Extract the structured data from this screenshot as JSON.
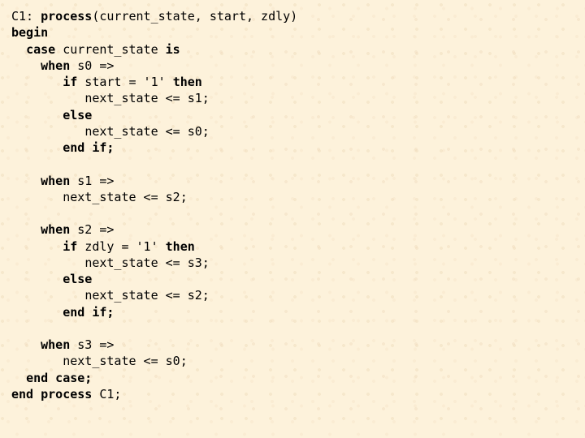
{
  "code": {
    "l01a": "C1: ",
    "l01b": "process",
    "l01c": "(current_state, start, zdly)",
    "l02": "begin",
    "l03a": "case",
    "l03b": " current_state ",
    "l03c": "is",
    "l04a": "when",
    "l04b": " s0 =>",
    "l05a": "if",
    "l05b": " start = '1' ",
    "l05c": "then",
    "l06": "next_state <= s1;",
    "l07": "else",
    "l08": "next_state <= s0;",
    "l09": "end if;",
    "l10a": "when",
    "l10b": " s1 =>",
    "l11": "next_state <= s2;",
    "l12a": "when",
    "l12b": " s2 =>",
    "l13a": "if",
    "l13b": " zdly = '1' ",
    "l13c": "then",
    "l14": "next_state <= s3;",
    "l15": "else",
    "l16": "next_state <= s2;",
    "l17": "end if;",
    "l18a": "when",
    "l18b": " s3 =>",
    "l19": "next_state <= s0;",
    "l20": "end case;",
    "l21a": "end process",
    "l21b": " C1;"
  }
}
